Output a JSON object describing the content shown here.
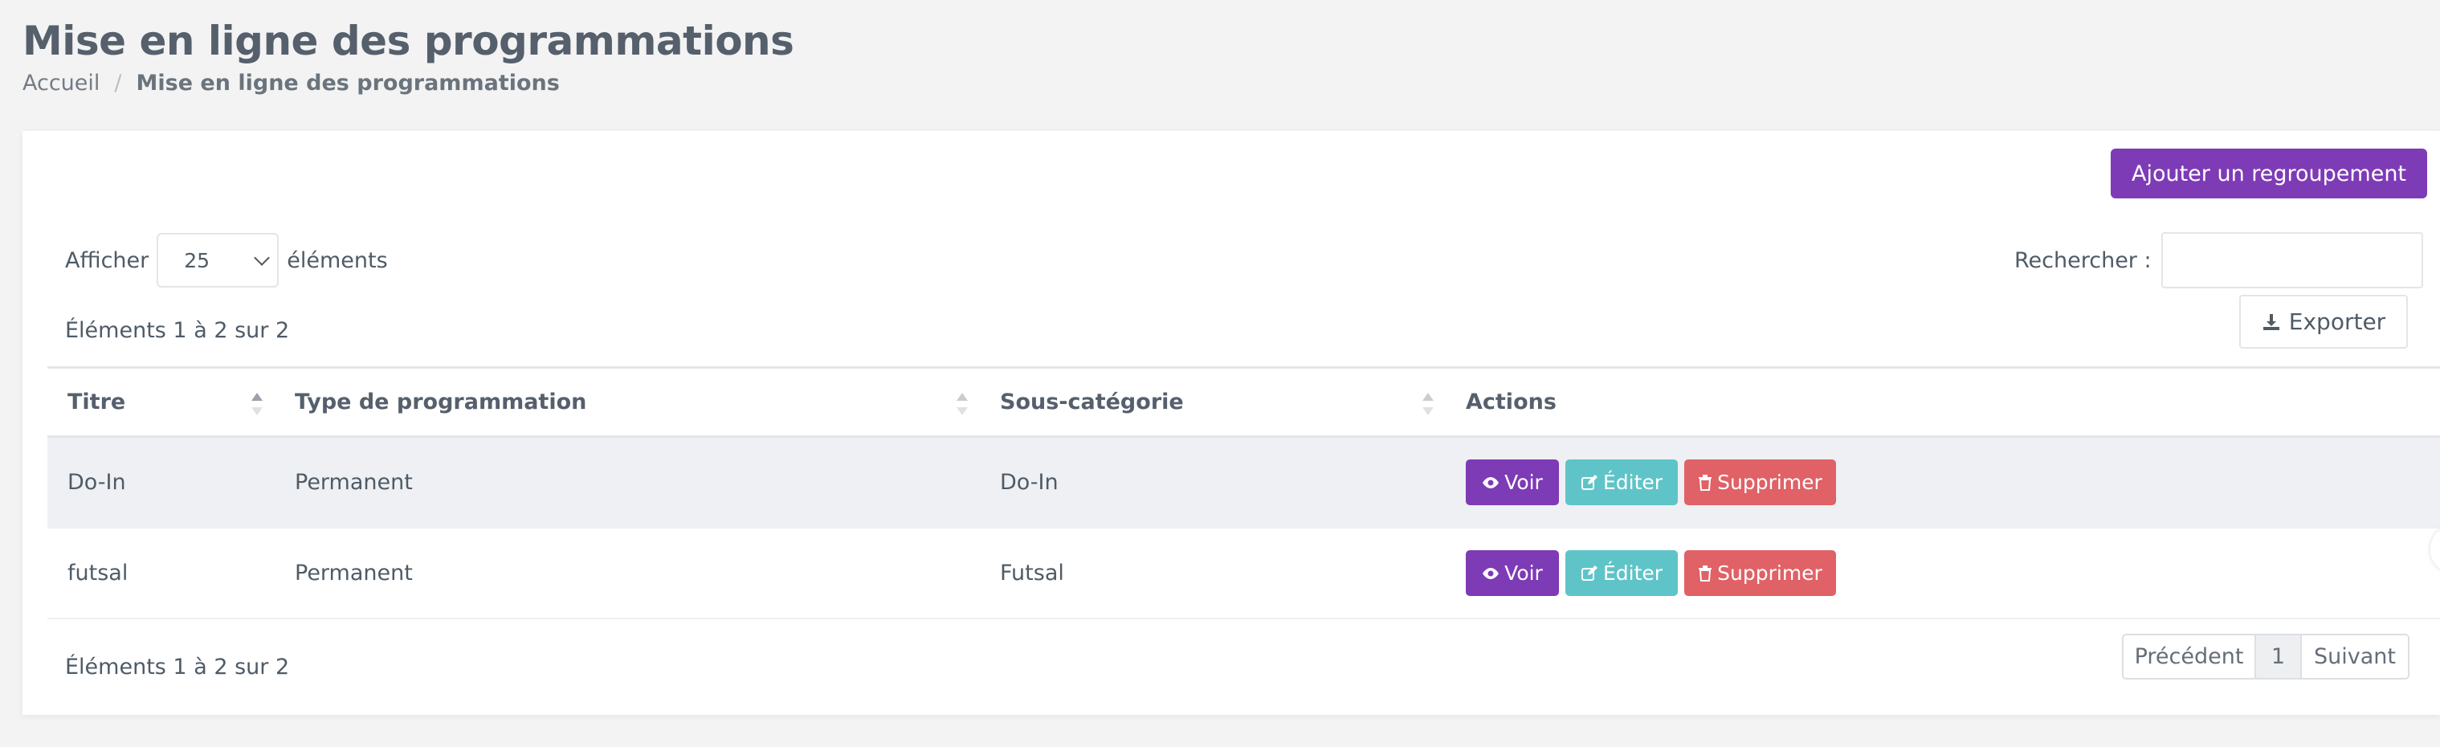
{
  "page": {
    "title": "Mise en ligne des programmations",
    "breadcrumb": {
      "home": "Accueil",
      "separator": "/",
      "current": "Mise en ligne des programmations"
    }
  },
  "toolbar": {
    "add_label": "Ajouter un regroupement",
    "export_label": "Exporter"
  },
  "length": {
    "prefix": "Afficher",
    "value": "25",
    "suffix": "éléments"
  },
  "search": {
    "label": "Rechercher :",
    "value": ""
  },
  "info": {
    "top": "Éléments 1 à 2 sur 2",
    "bottom": "Éléments 1 à 2 sur 2"
  },
  "table": {
    "headers": [
      "Titre",
      "Type de programmation",
      "Sous-catégorie",
      "Actions"
    ],
    "rows": [
      {
        "titre": "Do-In",
        "type": "Permanent",
        "sous_categorie": "Do-In"
      },
      {
        "titre": "futsal",
        "type": "Permanent",
        "sous_categorie": "Futsal"
      }
    ],
    "actions": {
      "view": "Voir",
      "edit": "Éditer",
      "delete": "Supprimer"
    }
  },
  "pagination": {
    "prev": "Précédent",
    "current": "1",
    "next": "Suivant"
  },
  "colors": {
    "primary": "#7e3bb6",
    "info": "#5fc4c8",
    "danger": "#e06166",
    "background": "#f3f3f4"
  },
  "icons": {
    "export": "download-icon",
    "view": "eye-icon",
    "edit": "edit-icon",
    "delete": "trash-icon",
    "sort": "sort-icon"
  }
}
